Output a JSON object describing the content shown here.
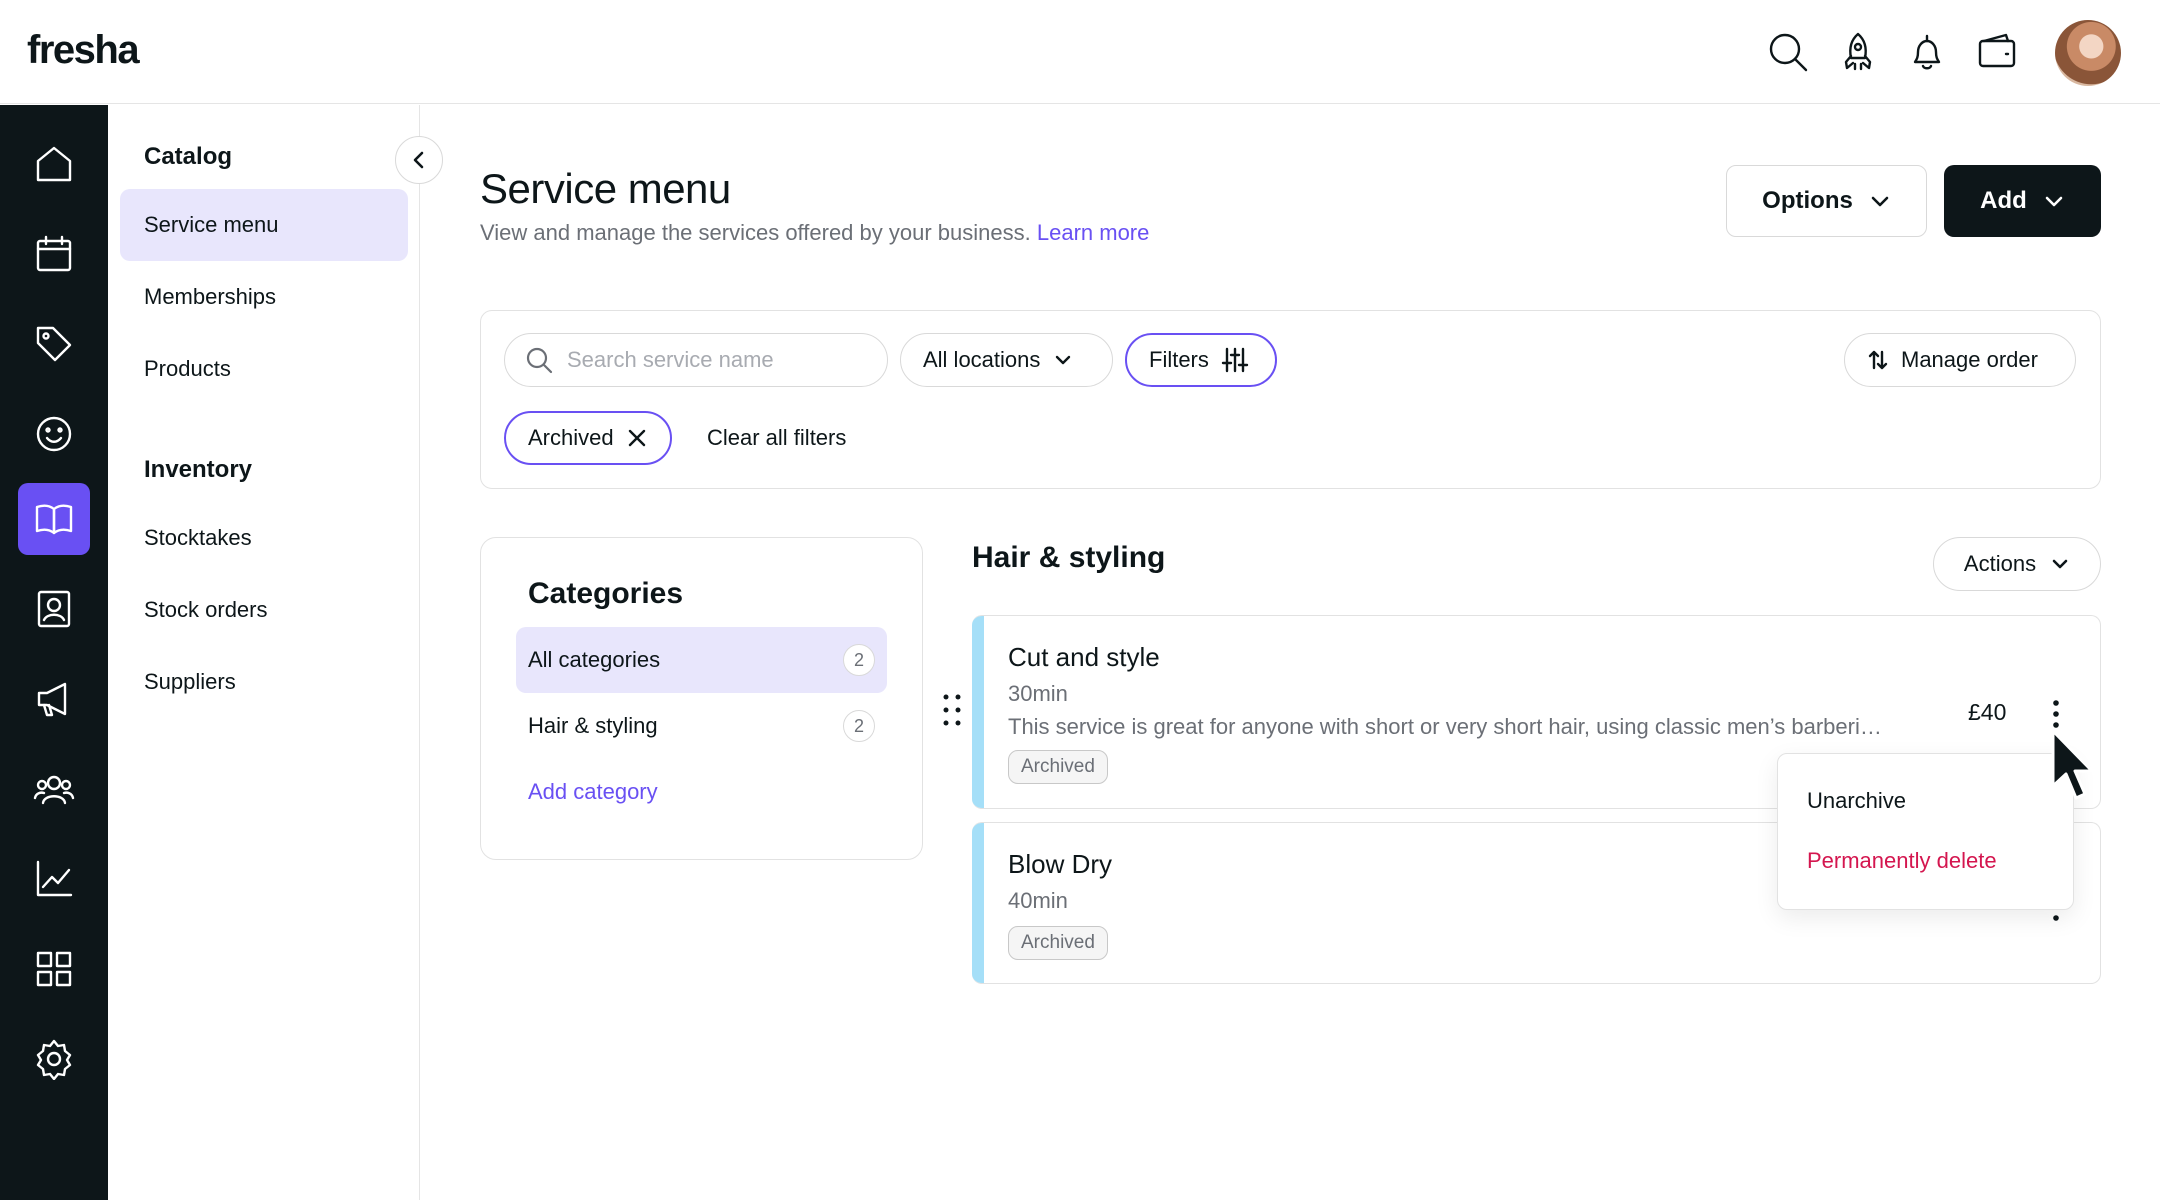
{
  "app": {
    "logo": "fresha"
  },
  "topbar": {
    "icons": [
      "search-icon",
      "rocket-icon",
      "bell-icon",
      "wallet-icon"
    ],
    "avatar": "user-avatar"
  },
  "rail": {
    "items": [
      "home-icon",
      "calendar-icon",
      "tag-icon",
      "smile-icon",
      "book-icon",
      "contact-icon",
      "megaphone-icon",
      "team-icon",
      "chart-icon",
      "apps-icon",
      "gear-icon"
    ],
    "active": "book-icon",
    "accent": "#6950f3"
  },
  "sidebar": {
    "catalog_heading": "Catalog",
    "catalog_items": [
      {
        "label": "Service menu",
        "active": true
      },
      {
        "label": "Memberships"
      },
      {
        "label": "Products"
      }
    ],
    "inventory_heading": "Inventory",
    "inventory_items": [
      {
        "label": "Stocktakes"
      },
      {
        "label": "Stock orders"
      },
      {
        "label": "Suppliers"
      }
    ]
  },
  "header": {
    "title": "Service menu",
    "subtitle": "View and manage the services offered by your business.",
    "learn_more": "Learn more",
    "options_label": "Options",
    "add_label": "Add"
  },
  "filters": {
    "search_placeholder": "Search service name",
    "locations_label": "All locations",
    "filters_label": "Filters",
    "manage_order_label": "Manage order",
    "active_chip": "Archived",
    "clear_label": "Clear all filters"
  },
  "categories": {
    "title": "Categories",
    "items": [
      {
        "label": "All categories",
        "count": "2",
        "active": true
      },
      {
        "label": "Hair & styling",
        "count": "2"
      }
    ],
    "add_label": "Add category"
  },
  "services": {
    "section_title": "Hair & styling",
    "actions_label": "Actions",
    "items": [
      {
        "name": "Cut and style",
        "duration": "30min",
        "description": "This service is great for anyone with short or very short hair, using classic men’s barbering ...",
        "tag": "Archived",
        "price": "£40"
      },
      {
        "name": "Blow Dry",
        "duration": "40min",
        "tag": "Archived"
      }
    ],
    "accent_color": "#a5dff8"
  },
  "context_menu": {
    "unarchive": "Unarchive",
    "delete": "Permanently delete",
    "delete_color": "#d4164f"
  }
}
